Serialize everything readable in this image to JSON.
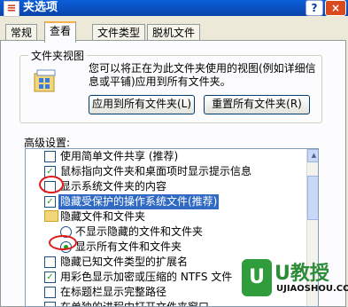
{
  "window": {
    "title": "文件夹选项",
    "title_visible": "夹选项",
    "help": "?",
    "close": "×",
    "app_icon": "folder-options-icon"
  },
  "tabs": [
    {
      "label": "常规"
    },
    {
      "label": "查看"
    },
    {
      "label": "文件类型"
    },
    {
      "label": "脱机文件"
    }
  ],
  "folder_views": {
    "group_label": "文件夹视图",
    "description": "您可以将正在为此文件夹使用的视图(例如详细信息或平铺)应用到所有文件夹。",
    "apply_all_label": "应用到所有文件夹(L)",
    "reset_all_label": "重置所有文件夹(R)"
  },
  "advanced": {
    "label": "高级设置:",
    "items": [
      {
        "type": "checkbox",
        "checked": false,
        "label": "使用简单文件共享 (推荐)"
      },
      {
        "type": "checkbox",
        "checked": true,
        "label": "鼠标指向文件夹和桌面项时显示提示信息"
      },
      {
        "type": "checkbox",
        "checked": false,
        "label": "显示系统文件夹的内容"
      },
      {
        "type": "checkbox",
        "checked": true,
        "selected": true,
        "label": "隐藏受保护的操作系统文件(推荐)"
      },
      {
        "type": "folder",
        "label": "隐藏文件和文件夹"
      },
      {
        "type": "radio",
        "checked": false,
        "label": "不显示隐藏的文件和文件夹"
      },
      {
        "type": "radio",
        "checked": true,
        "label": "显示所有文件和文件夹"
      },
      {
        "type": "checkbox",
        "checked": false,
        "label": "隐藏已知文件类型的扩展名"
      },
      {
        "type": "checkbox",
        "checked": true,
        "label": "用彩色显示加密或压缩的 NTFS 文件"
      },
      {
        "type": "checkbox",
        "checked": false,
        "label": "在标题栏显示完整路径"
      },
      {
        "type": "checkbox",
        "checked": false,
        "label": "在单独的进程中打开文件夹窗口"
      }
    ]
  },
  "watermark": {
    "brand": "U教授",
    "url": "UJIAOSHOU.COM"
  },
  "colors": {
    "title_bar": "#0b4fc0",
    "selection": "#316ac5",
    "annotation": "#e01919",
    "check": "#21a121"
  }
}
